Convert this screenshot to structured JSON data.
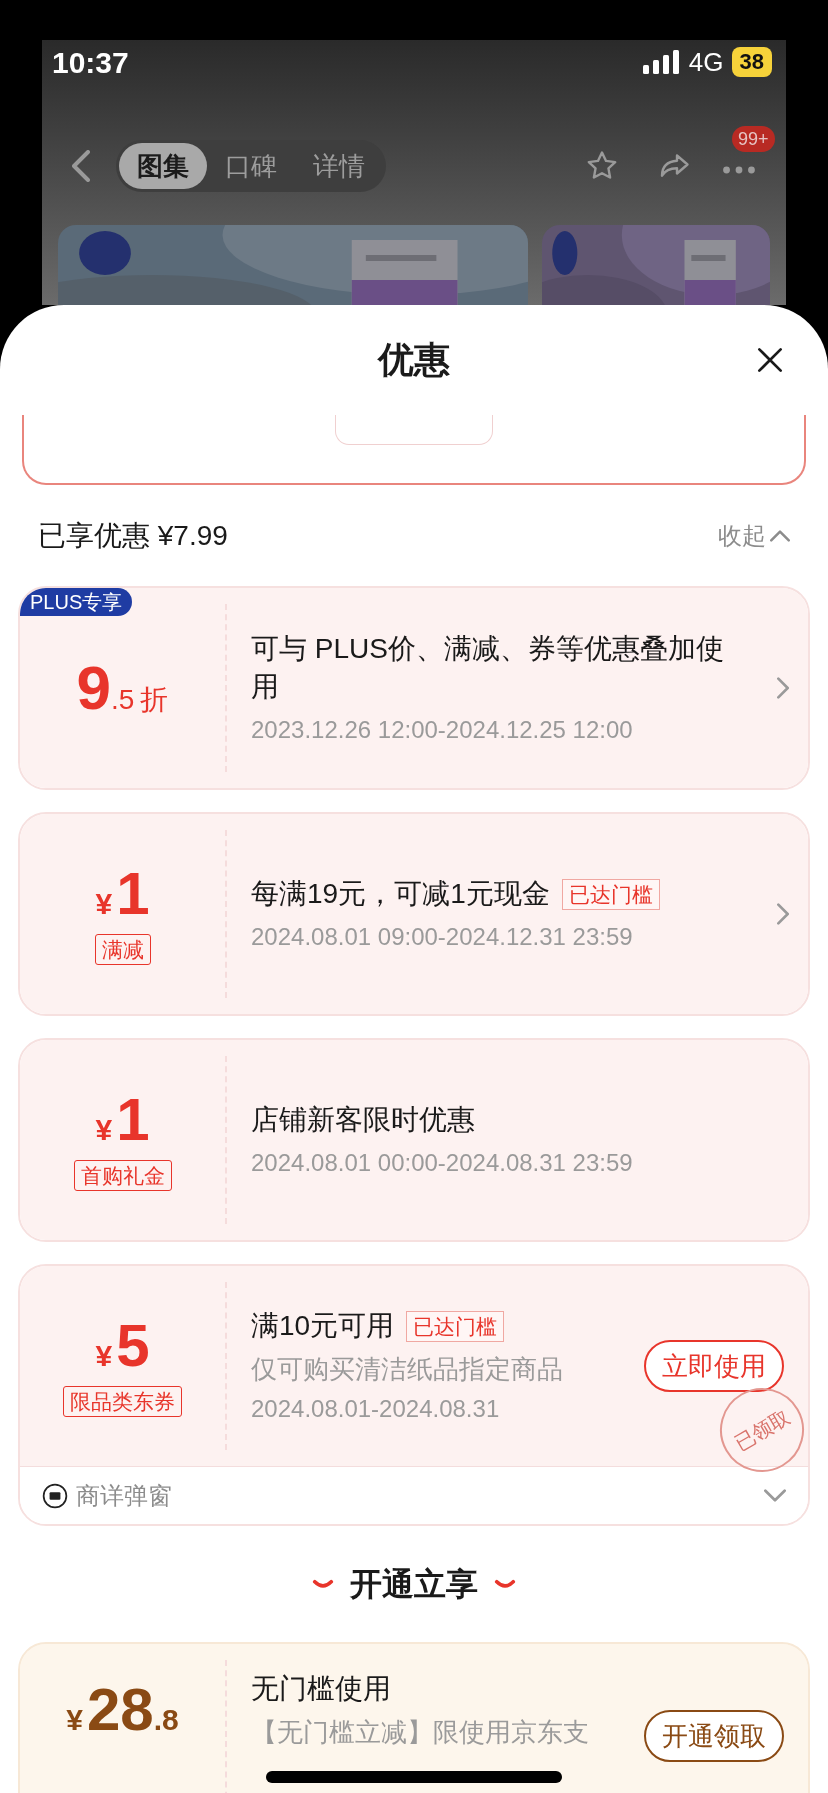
{
  "status_bar": {
    "time": "10:37",
    "network": "4G",
    "battery": "38"
  },
  "nav": {
    "tabs": [
      {
        "label": "图集",
        "selected": true
      },
      {
        "label": "口碑",
        "selected": false
      },
      {
        "label": "详情",
        "selected": false
      }
    ],
    "badge": "99+"
  },
  "sheet": {
    "title": "优惠"
  },
  "summary": {
    "label": "已享优惠 ¥7.99",
    "collapse": "收起"
  },
  "coupons": [
    {
      "kind": "discount",
      "badge": "PLUS专享",
      "value": "9",
      "decimal": ".5",
      "unit": "折",
      "title": "可与 PLUS价、满减、券等优惠叠加使用",
      "date": "2023.12.26 12:00-2024.12.25 12:00",
      "chevron": true
    },
    {
      "kind": "amount",
      "currency": "¥",
      "value": "1",
      "tag": "满减",
      "title": "每满19元，可减1元现金",
      "threshold": "已达门槛",
      "date": "2024.08.01 09:00-2024.12.31 23:59",
      "chevron": true
    },
    {
      "kind": "amount",
      "currency": "¥",
      "value": "1",
      "tag": "首购礼金",
      "title": "店铺新客限时优惠",
      "date": "2024.08.01 00:00-2024.08.31 23:59",
      "chevron": false
    },
    {
      "kind": "amount",
      "currency": "¥",
      "value": "5",
      "tag": "限品类东券",
      "title": "满10元可用",
      "threshold": "已达门槛",
      "description": "仅可购买清洁纸品指定商品",
      "date": "2024.08.01-2024.08.31",
      "action": "立即使用",
      "stamp": "已领取",
      "chevron": false,
      "footer": "商详弹窗"
    }
  ],
  "section_title": "开通立享",
  "plus_coupons": [
    {
      "kind": "amount",
      "currency": "¥",
      "value": "28",
      "decimal": ".8",
      "title": "无门槛使用",
      "description": "【无门槛立减】限使用京东支",
      "action": "开通领取",
      "chevron": false
    }
  ]
}
